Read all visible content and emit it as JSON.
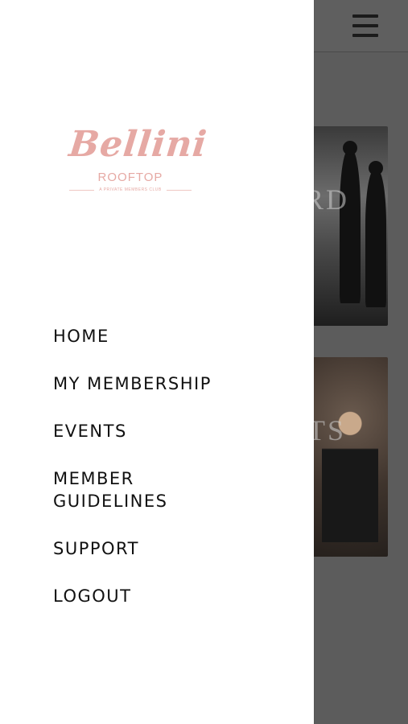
{
  "background": {
    "cards": [
      {
        "title": "RD"
      },
      {
        "title": "TS"
      }
    ]
  },
  "header": {
    "menu_icon": "hamburger-icon"
  },
  "drawer": {
    "logo": {
      "script": "Bellini",
      "sub": "ROOFTOP",
      "tagline": "A PRIVATE MEMBERS CLUB",
      "color": "#e6a9a4"
    },
    "menu": [
      {
        "label": "HOME"
      },
      {
        "label": "MY MEMBERSHIP"
      },
      {
        "label": "EVENTS"
      },
      {
        "label": "MEMBER GUIDELINES"
      },
      {
        "label": "SUPPORT"
      },
      {
        "label": "LOGOUT"
      }
    ]
  }
}
